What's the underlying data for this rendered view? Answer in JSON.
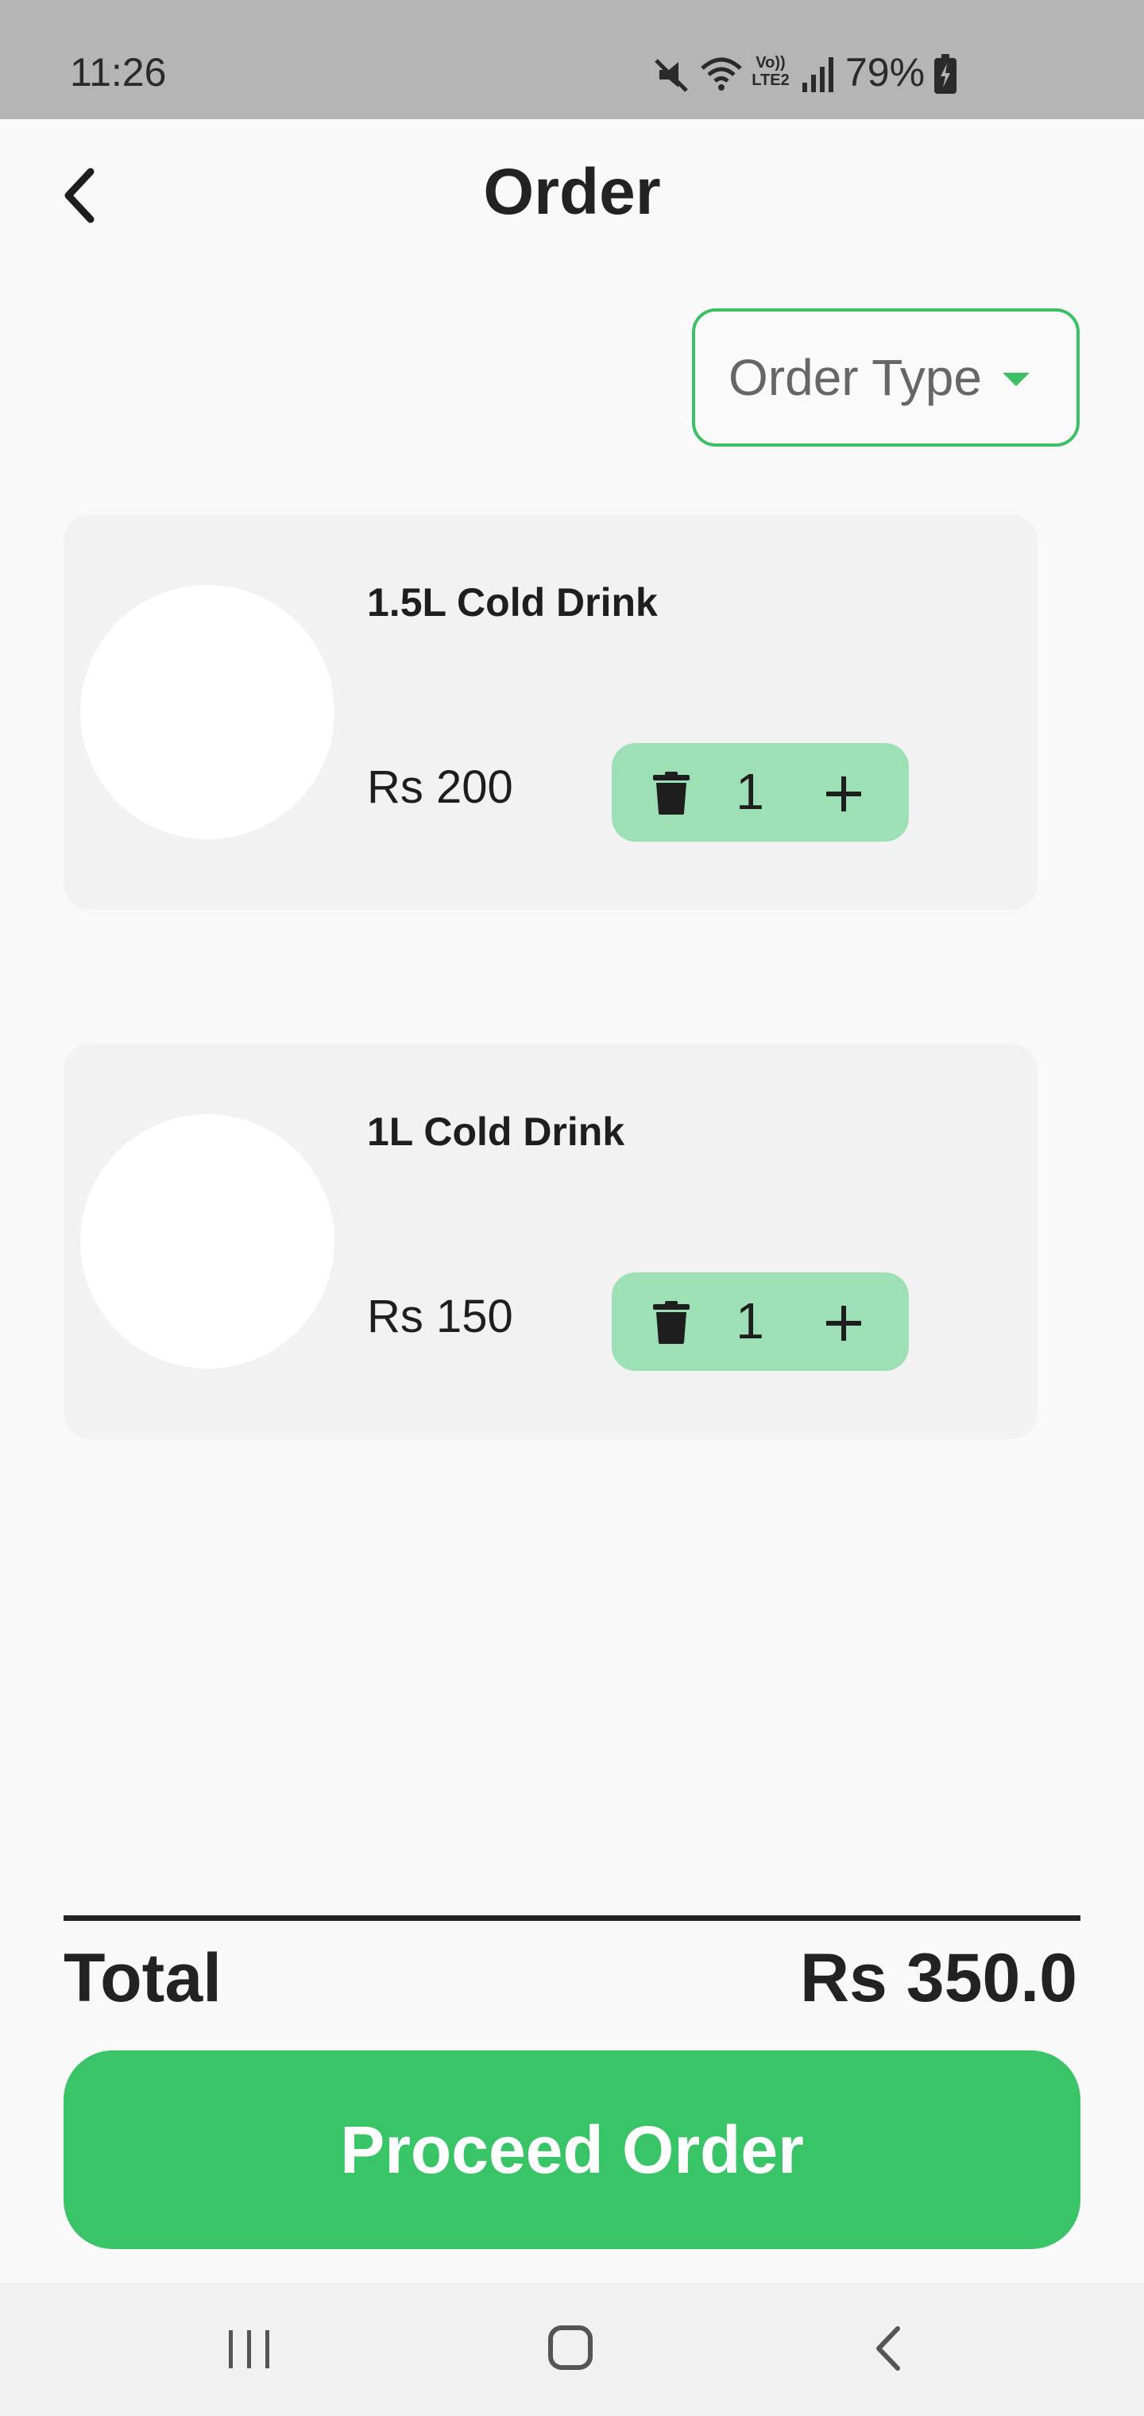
{
  "status_bar": {
    "time": "11:26",
    "battery": "79%",
    "lte_label_1": "Vo))",
    "lte_label_2": "LTE2"
  },
  "header": {
    "title": "Order"
  },
  "order_type": {
    "label": "Order Type"
  },
  "items": [
    {
      "name": "1.5L Cold Drink",
      "price": "Rs 200",
      "quantity": "1"
    },
    {
      "name": "1L Cold Drink",
      "price": "Rs 150",
      "quantity": "1"
    }
  ],
  "total": {
    "label": "Total",
    "value": "Rs 350.0"
  },
  "proceed": {
    "label": "Proceed Order"
  },
  "colors": {
    "accent": "#3ac468",
    "stepper": "#9de0b5",
    "card": "#f2f2f2"
  }
}
